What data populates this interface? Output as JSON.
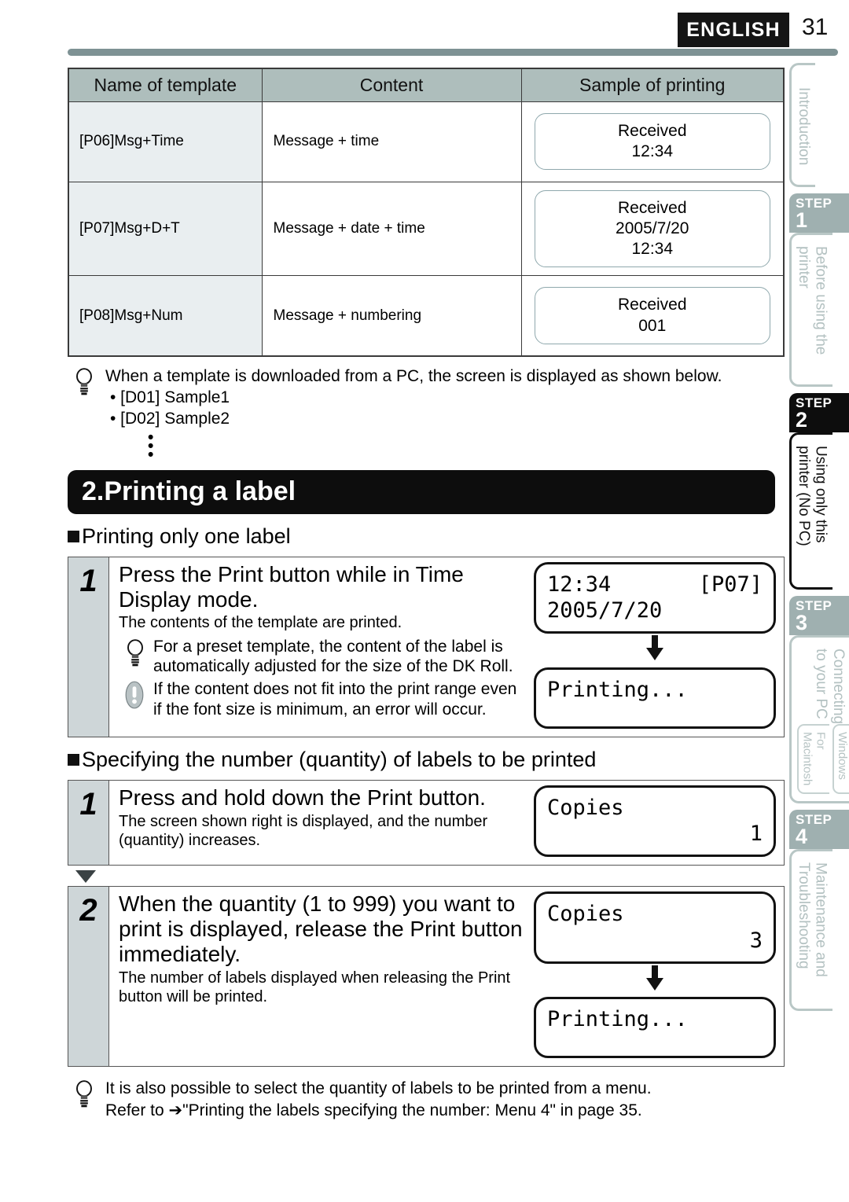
{
  "header": {
    "language_badge": "ENGLISH",
    "page_number": "31"
  },
  "template_table": {
    "columns": [
      "Name of template",
      "Content",
      "Sample of printing"
    ],
    "rows": [
      {
        "name": "[P06]Msg+Time",
        "content": "Message + time",
        "sample": [
          "Received",
          "12:34"
        ]
      },
      {
        "name": "[P07]Msg+D+T",
        "content": "Message + date + time",
        "sample": [
          "Received",
          "2005/7/20",
          "12:34"
        ]
      },
      {
        "name": "[P08]Msg+Num",
        "content": "Message + numbering",
        "sample": [
          "Received",
          "001"
        ]
      }
    ]
  },
  "download_note": {
    "icon": "bulb-icon",
    "line": "When a template is downloaded from a PC, the screen is displayed as shown below.",
    "items": [
      "• [D01] Sample1",
      "• [D02] Sample2"
    ],
    "ellipsis": [
      "•",
      "•",
      "•"
    ]
  },
  "section": {
    "banner_title": "2.Printing a label",
    "sub1": "Printing only one label",
    "sub2": "Specifying the number (quantity) of labels to be printed"
  },
  "step1a": {
    "number": "1",
    "title": "Press the Print button while in Time Display mode.",
    "desc": "The contents of the template are printed.",
    "tip": "For a preset template, the content of the label is automatically adjusted for the size of the DK Roll.",
    "warning": "If the content does not fit into the print range even if the font size is minimum, an error will occur.",
    "lcd1_left": "12:34",
    "lcd1_right": "[P07]",
    "lcd1_line2": "2005/7/20",
    "lcd2": "Printing..."
  },
  "step2a": {
    "number": "1",
    "title": "Press and hold down the Print button.",
    "desc": "The screen shown right is displayed, and the number (quantity) increases.",
    "lcd_label": "Copies",
    "lcd_value": "1"
  },
  "step2b": {
    "number": "2",
    "title": "When the quantity (1 to 999) you want to print is displayed, release the Print button immediately.",
    "desc": "The number of labels displayed when releasing the Print button will be printed.",
    "lcd_label": "Copies",
    "lcd_value": "3",
    "lcd2": "Printing..."
  },
  "footer_note": {
    "icon": "bulb-icon",
    "line1": "It is also possible to select the quantity of labels to be printed from a menu.",
    "line2": "Refer to ➔\"Printing the labels specifying the number: Menu 4\" in page 35."
  },
  "sidebar": {
    "tabs": [
      {
        "step_label": "",
        "step_num": "",
        "title": "Introduction",
        "active": false,
        "subtabs": []
      },
      {
        "step_label": "STEP",
        "step_num": "1",
        "title": "Before using the printer",
        "active": false,
        "subtabs": []
      },
      {
        "step_label": "STEP",
        "step_num": "2",
        "title": "Using only this printer (No PC)",
        "active": true,
        "subtabs": []
      },
      {
        "step_label": "STEP",
        "step_num": "3",
        "title": "Connecting to your PC",
        "active": false,
        "subtabs": [
          "For Windows",
          "For Macintosh"
        ]
      },
      {
        "step_label": "STEP",
        "step_num": "4",
        "title": "Maintenance and Troubleshooting",
        "active": false,
        "subtabs": []
      }
    ]
  },
  "colors": {
    "banner_black": "#0d0d0d",
    "rule_green": "#7e9294",
    "table_header": "#aebebc",
    "table_name_bg": "#e9eef0",
    "step_num_bg": "#ced6d8",
    "sidebar_inactive": "#9fb0b0"
  }
}
